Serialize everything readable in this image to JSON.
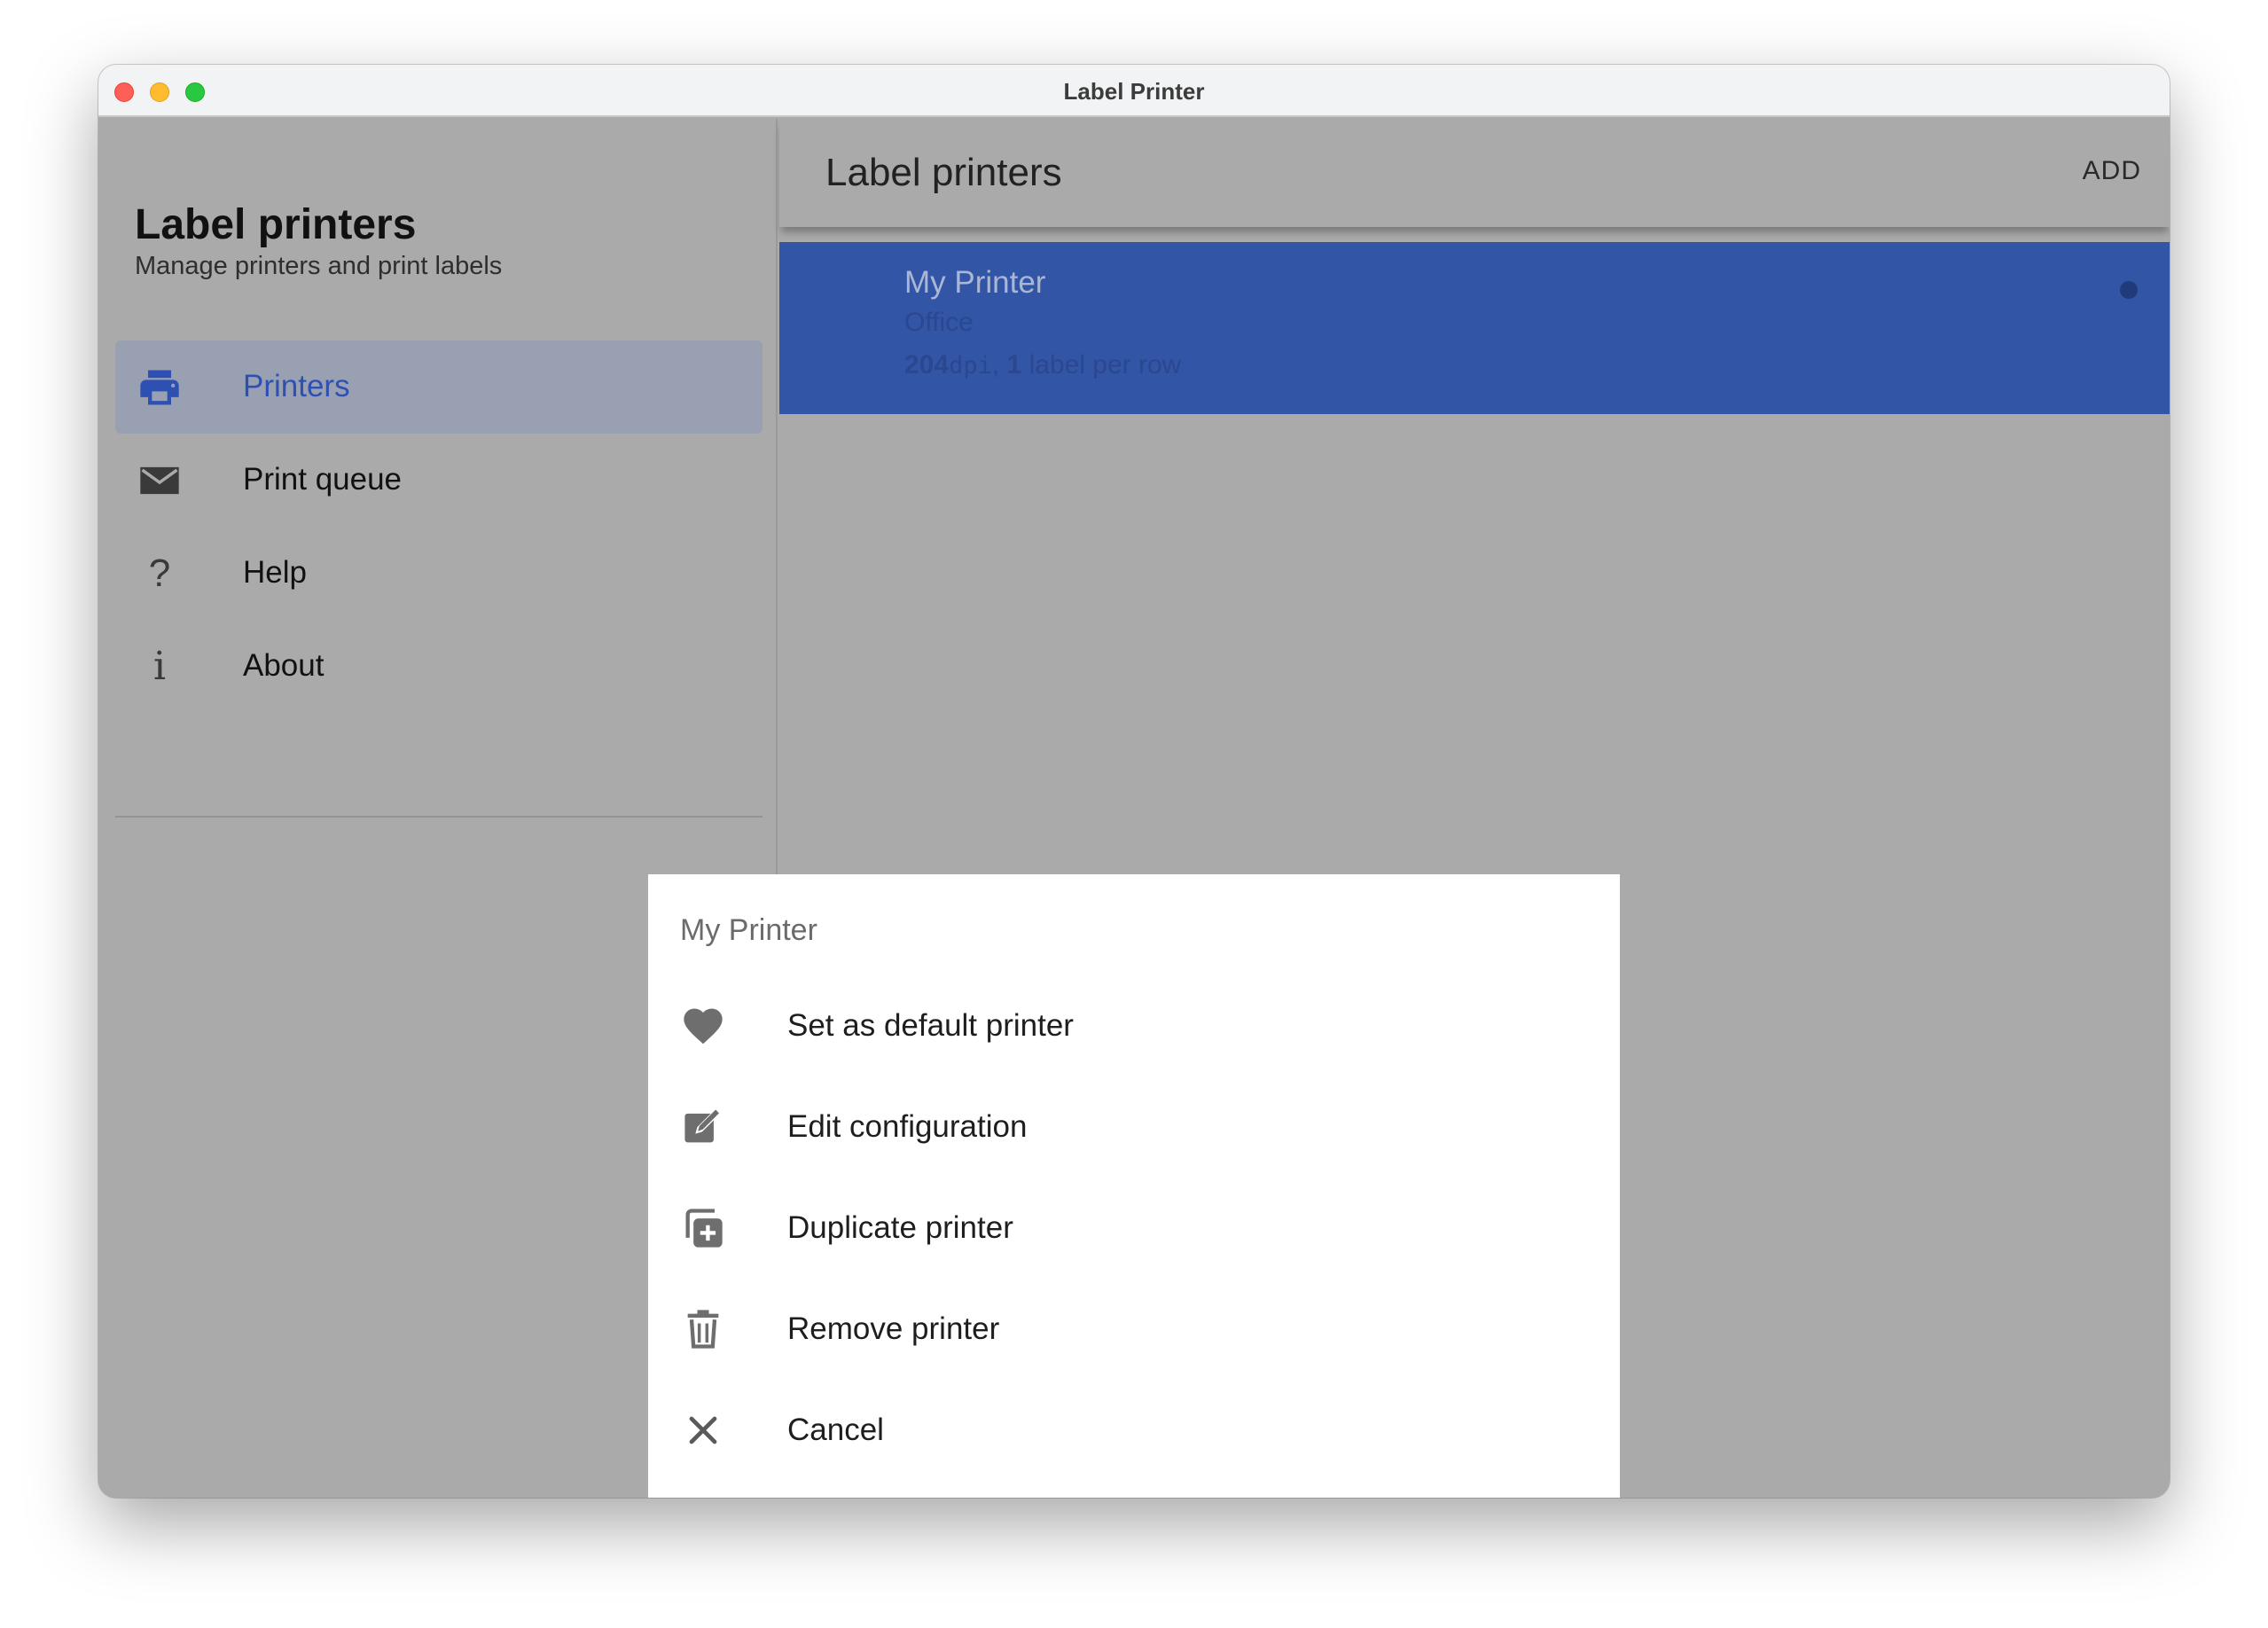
{
  "window": {
    "title": "Label Printer"
  },
  "sidebar": {
    "title": "Label printers",
    "subtitle": "Manage printers and print labels",
    "items": [
      {
        "label": "Printers",
        "icon": "printer-icon",
        "active": true
      },
      {
        "label": "Print queue",
        "icon": "envelope-icon",
        "active": false
      },
      {
        "label": "Help",
        "icon": "question-icon",
        "active": false
      },
      {
        "label": "About",
        "icon": "info-icon",
        "active": false
      }
    ]
  },
  "main": {
    "title": "Label printers",
    "add_label": "ADD",
    "printer": {
      "name": "My Printer",
      "location": "Office",
      "dpi_value": "204",
      "dpi_unit": "dpi",
      "separator": ",",
      "labels_count": "1",
      "labels_text": "label per row"
    }
  },
  "action_sheet": {
    "title": "My Printer",
    "items": [
      {
        "label": "Set as default printer",
        "icon": "heart-icon"
      },
      {
        "label": "Edit configuration",
        "icon": "edit-icon"
      },
      {
        "label": "Duplicate printer",
        "icon": "duplicate-icon"
      },
      {
        "label": "Remove printer",
        "icon": "trash-icon"
      },
      {
        "label": "Cancel",
        "icon": "close-icon"
      }
    ]
  },
  "colors": {
    "accent": "#2f50b3",
    "selected_row": "#3355a6",
    "overlay": "#aaaaaa",
    "sheet_background": "#ffffff"
  }
}
